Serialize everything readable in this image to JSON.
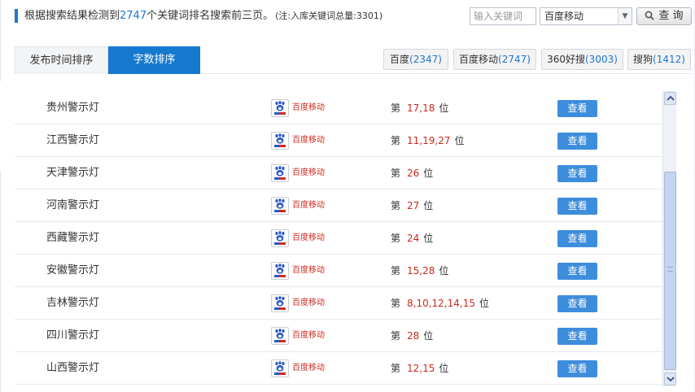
{
  "header": {
    "summary_prefix": "根据搜索结果检测到",
    "result_count": "2747",
    "summary_suffix": "个关键词排名搜索前三页。",
    "note": "(注:入库关键词总量:3301)",
    "search_placeholder": "输入关键词",
    "engine_selected": "百度移动",
    "query_label": "查 询"
  },
  "tabs": [
    {
      "label": "发布时间排序",
      "active": false
    },
    {
      "label": "字数排序",
      "active": true
    }
  ],
  "engine_tabs": [
    {
      "name": "百度",
      "count": "(2347)"
    },
    {
      "name": "百度移动",
      "count": "(2747)"
    },
    {
      "name": "360好搜",
      "count": "(3003)"
    },
    {
      "name": "搜狗",
      "count": "(1412)"
    }
  ],
  "list": {
    "rank_prefix": "第",
    "rank_suffix": "位",
    "view_label": "查看",
    "engine_name": "百度移动",
    "rows": [
      {
        "keyword": "贵州警示灯",
        "ranks": "17,18"
      },
      {
        "keyword": "江西警示灯",
        "ranks": "11,19,27"
      },
      {
        "keyword": "天津警示灯",
        "ranks": "26"
      },
      {
        "keyword": "河南警示灯",
        "ranks": "27"
      },
      {
        "keyword": "西藏警示灯",
        "ranks": "24"
      },
      {
        "keyword": "安徽警示灯",
        "ranks": "15,28"
      },
      {
        "keyword": "吉林警示灯",
        "ranks": "8,10,12,14,15"
      },
      {
        "keyword": "四川警示灯",
        "ranks": "28"
      },
      {
        "keyword": "山西警示灯",
        "ranks": "12,15"
      }
    ]
  },
  "icons": {
    "search": "magnifier-icon",
    "dropdown": "triangle-down-icon",
    "engine_logo": "baidu-paw-icon",
    "scroll_up": "chevron-up-icon",
    "scroll_down": "chevron-down-icon"
  },
  "colors": {
    "accent": "#1e76d2",
    "active_tab": "#1679d0",
    "rank_highlight": "#cc2a1d",
    "view_button": "#3d8ddd"
  },
  "scroll": {
    "position_fraction": 0.37,
    "visible_fraction": 0.69
  }
}
